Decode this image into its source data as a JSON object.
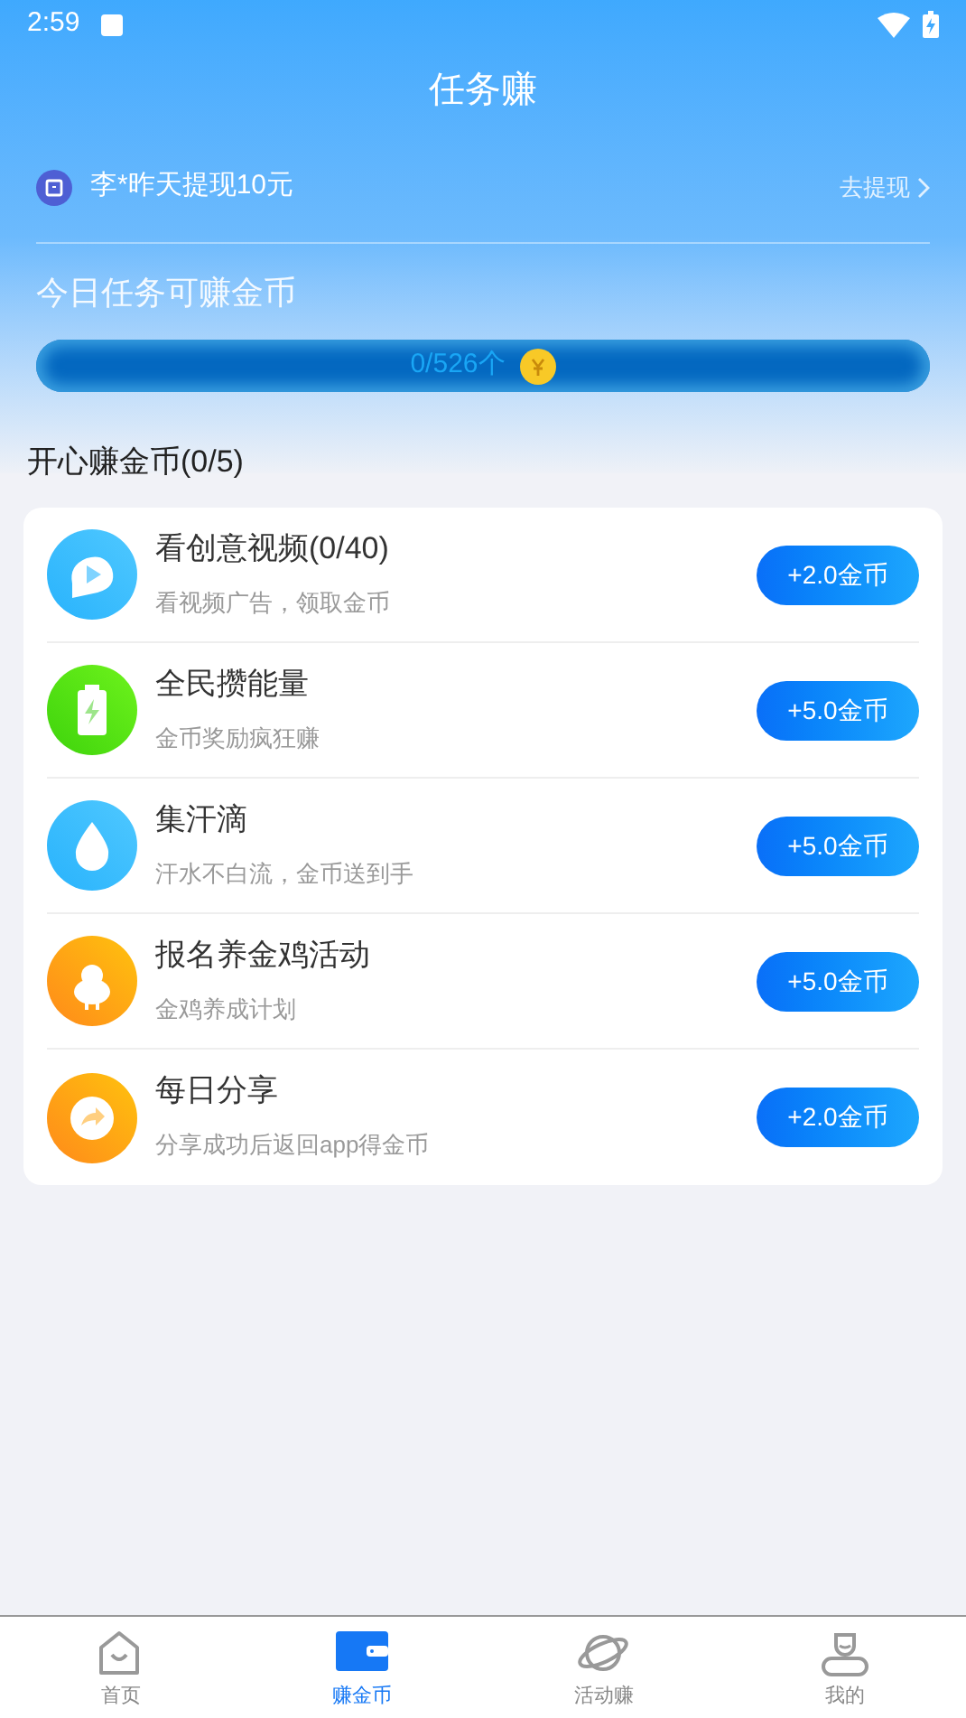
{
  "status_bar": {
    "time": "2:59"
  },
  "header": {
    "title": "任务赚"
  },
  "notice": {
    "text": "李*昨天提现10元",
    "link": "去提现"
  },
  "daily": {
    "title": "今日任务可赚金币",
    "progress_text": "0/526个",
    "level": 0
  },
  "section": {
    "title": "开心赚金币(0/5)"
  },
  "tasks": [
    {
      "kind": "video",
      "title": "看创意视频(0/40)",
      "subtitle": "看视频广告，领取金币",
      "reward": "+2.0金币"
    },
    {
      "kind": "battery",
      "title": "全民攒能量",
      "subtitle": "金币奖励疯狂赚",
      "reward": "+5.0金币"
    },
    {
      "kind": "drop",
      "title": "集汗滴",
      "subtitle": "汗水不白流，金币送到手",
      "reward": "+5.0金币"
    },
    {
      "kind": "chick",
      "title": "报名养金鸡活动",
      "subtitle": "金鸡养成计划",
      "reward": "+5.0金币"
    },
    {
      "kind": "share",
      "title": "每日分享",
      "subtitle": "分享成功后返回app得金币",
      "reward": "+2.0金币"
    }
  ],
  "tabs": [
    {
      "kind": "home",
      "label": "首页",
      "selected": false
    },
    {
      "kind": "wallet",
      "label": "赚金币",
      "selected": true
    },
    {
      "kind": "planet",
      "label": "活动赚",
      "selected": false
    },
    {
      "kind": "user",
      "label": "我的",
      "selected": false
    }
  ]
}
